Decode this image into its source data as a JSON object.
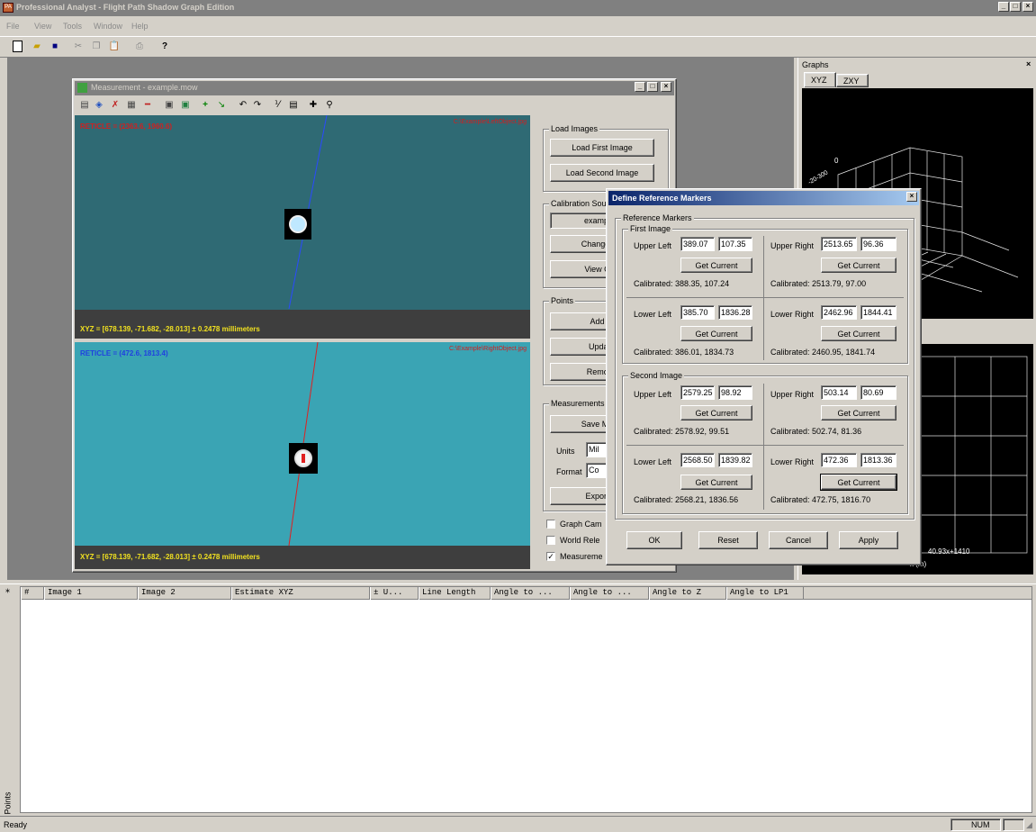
{
  "app": {
    "title": "Professional Analyst - Flight Path Shadow Graph Edition",
    "menu": [
      "File",
      "View",
      "Tools",
      "Window",
      "Help"
    ],
    "status_text": "Ready",
    "status_num": "NUM"
  },
  "measurement_window": {
    "title": "Measurement - example.mow",
    "top_image": {
      "reticle": "RETICLE = (2363.6, 1960.6)",
      "filename": "C:\\Example\\LeftObject.jpg",
      "xyz": "XYZ = [678.139, -71.682, -28.013]   ± 0.2478 millimeters"
    },
    "bottom_image": {
      "reticle": "RETICLE = (472.6, 1813.4)",
      "filename": "C:\\Example\\RightObject.jpg",
      "xyz": "XYZ = [678.139, -71.682, -28.013]   ± 0.2478 millimeters"
    },
    "side": {
      "load_images_label": "Load Images",
      "load_first": "Load First Image",
      "load_second": "Load Second Image",
      "calibration_label": "Calibration Sou",
      "calibration_value": "example",
      "change_button": "Change C",
      "view_button": "View Ca",
      "points_label": "Points",
      "add_button": "Add I",
      "update_button": "Updat",
      "remove_button": "Remov",
      "measurements_label": "Measurements",
      "save_button": "Save Mea",
      "units_label": "Units",
      "units_value": "Mil",
      "format_label": "Format",
      "format_value": "Co",
      "export_button": "Export I",
      "graph_checkbox": "Graph Cam",
      "world_checkbox": "World Rele",
      "measurements_checkbox": "Measureme"
    }
  },
  "graphs_panel": {
    "title": "Graphs",
    "tabs": [
      "XYZ",
      "ZXY"
    ],
    "axis_label_0": "0",
    "axis_label_neg": "-20-300",
    "footer_label": "40.93x+1410",
    "footer_axis": "x (m)"
  },
  "dialog": {
    "title": "Define Reference Markers",
    "group_label": "Reference Markers",
    "first_label": "First Image",
    "second_label": "Second Image",
    "upper_left": "Upper Left",
    "upper_right": "Upper Right",
    "lower_left": "Lower Left",
    "lower_right": "Lower Right",
    "get_current": "Get Current",
    "first": {
      "ul": [
        "389.07",
        "107.35"
      ],
      "ul_cal": "Calibrated: 388.35, 107.24",
      "ur": [
        "2513.65",
        "96.36"
      ],
      "ur_cal": "Calibrated: 2513.79, 97.00",
      "ll": [
        "385.70",
        "1836.28"
      ],
      "ll_cal": "Calibrated: 386.01, 1834.73",
      "lr": [
        "2462.96",
        "1844.41"
      ],
      "lr_cal": "Calibrated: 2460.95, 1841.74"
    },
    "second": {
      "ul": [
        "2579.25",
        "98.92"
      ],
      "ul_cal": "Calibrated: 2578.92, 99.51",
      "ur": [
        "503.14",
        "80.69"
      ],
      "ur_cal": "Calibrated: 502.74, 81.36",
      "ll": [
        "2568.50",
        "1839.82"
      ],
      "ll_cal": "Calibrated: 2568.21, 1836.56",
      "lr": [
        "472.36",
        "1813.36"
      ],
      "lr_cal": "Calibrated: 472.75, 1816.70"
    },
    "ok": "OK",
    "reset": "Reset",
    "cancel": "Cancel",
    "apply": "Apply"
  },
  "points_table": {
    "side_label": "Points",
    "columns": [
      "#",
      "Image 1",
      "Image 2",
      "Estimate XYZ",
      "± U...",
      "Line Length",
      "Angle to ...",
      "Angle to ...",
      "Angle to Z",
      "Angle to LP1"
    ]
  }
}
